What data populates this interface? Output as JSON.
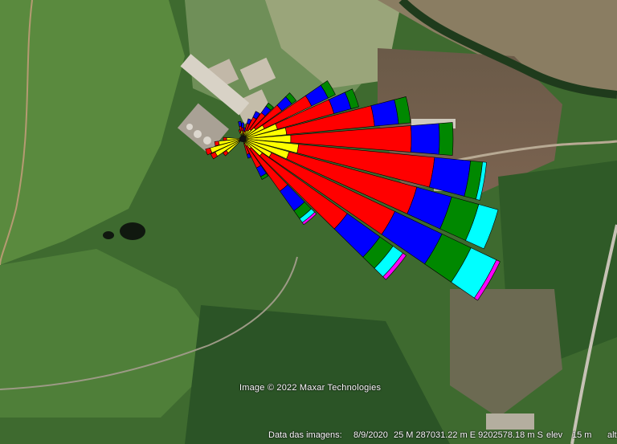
{
  "map": {
    "attribution": "Image © 2022 Maxar Technologies",
    "imagery_date_label": "Data das imagens:",
    "imagery_date_value": "8/9/2020",
    "coordinates": "25 M 287031.22 m E 9202578.18 m S",
    "elevation_label": "elev",
    "elevation_value": "15 m",
    "altitude_label": "alt"
  },
  "wind_rose": {
    "colors": {
      "yellow": "#ffff00",
      "red": "#ff0000",
      "blue": "#0000ff",
      "green": "#008800",
      "cyan": "#00ffff",
      "magenta": "#ff00ff"
    }
  }
}
